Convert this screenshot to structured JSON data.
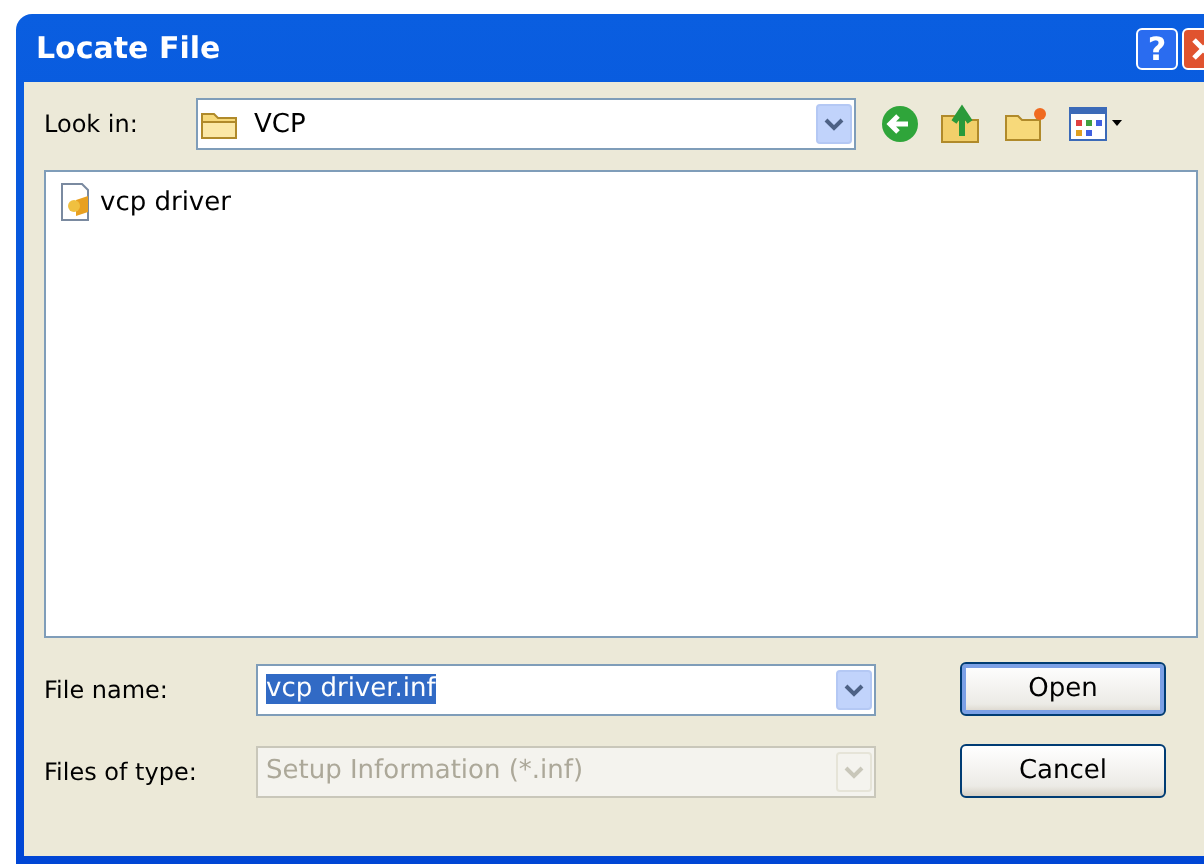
{
  "window": {
    "title": "Locate File"
  },
  "title_buttons": [
    {
      "kind": "help",
      "label": "?"
    },
    {
      "kind": "close"
    }
  ],
  "look_in": {
    "label": "Look in:",
    "value": "VCP"
  },
  "toolbar": [
    {
      "kind": "back"
    },
    {
      "kind": "up"
    },
    {
      "kind": "new-folder"
    },
    {
      "kind": "views"
    }
  ],
  "files": [
    {
      "name": "vcp driver",
      "selected": false
    }
  ],
  "file_name": {
    "label": "File name:",
    "value": "vcp driver.inf",
    "selected": true,
    "disabled": false
  },
  "file_type": {
    "label": "Files of type:",
    "value": "Setup Information (*.inf)",
    "disabled": true
  },
  "buttons": [
    {
      "label": "Open",
      "default": true
    },
    {
      "label": "Cancel",
      "default": false
    }
  ]
}
